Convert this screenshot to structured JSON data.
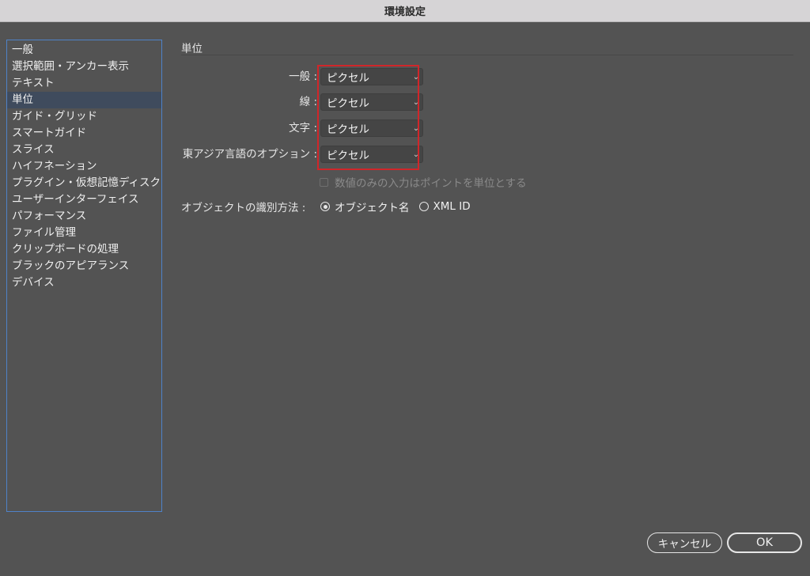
{
  "window": {
    "title": "環境設定"
  },
  "sidebar": {
    "items": [
      {
        "label": "一般"
      },
      {
        "label": "選択範囲・アンカー表示"
      },
      {
        "label": "テキスト"
      },
      {
        "label": "単位",
        "selected": true
      },
      {
        "label": "ガイド・グリッド"
      },
      {
        "label": "スマートガイド"
      },
      {
        "label": "スライス"
      },
      {
        "label": "ハイフネーション"
      },
      {
        "label": "プラグイン・仮想記憶ディスク"
      },
      {
        "label": "ユーザーインターフェイス"
      },
      {
        "label": "パフォーマンス"
      },
      {
        "label": "ファイル管理"
      },
      {
        "label": "クリップボードの処理"
      },
      {
        "label": "ブラックのアピアランス"
      },
      {
        "label": "デバイス"
      }
    ]
  },
  "panel": {
    "title": "単位",
    "units": {
      "general": {
        "label": "一般 :",
        "value": "ピクセル"
      },
      "stroke": {
        "label": "線 :",
        "value": "ピクセル"
      },
      "type": {
        "label": "文字 :",
        "value": "ピクセル"
      },
      "east_asian": {
        "label": "東アジア言語のオプション :",
        "value": "ピクセル"
      }
    },
    "numbers_without_units": {
      "label": "数値のみの入力はポイントを単位とする",
      "checked": false,
      "disabled": true
    },
    "identify_objects": {
      "label": "オブジェクトの識別方法 :",
      "options": [
        {
          "label": "オブジェクト名",
          "selected": true
        },
        {
          "label": "XML ID",
          "selected": false
        }
      ]
    }
  },
  "footer": {
    "cancel_label": "キャンセル",
    "ok_label": "OK"
  },
  "colors": {
    "background": "#535353",
    "sidebar_border": "#4f82c8",
    "selected_row": "#3f4b5d",
    "highlight": "#d0262a"
  }
}
